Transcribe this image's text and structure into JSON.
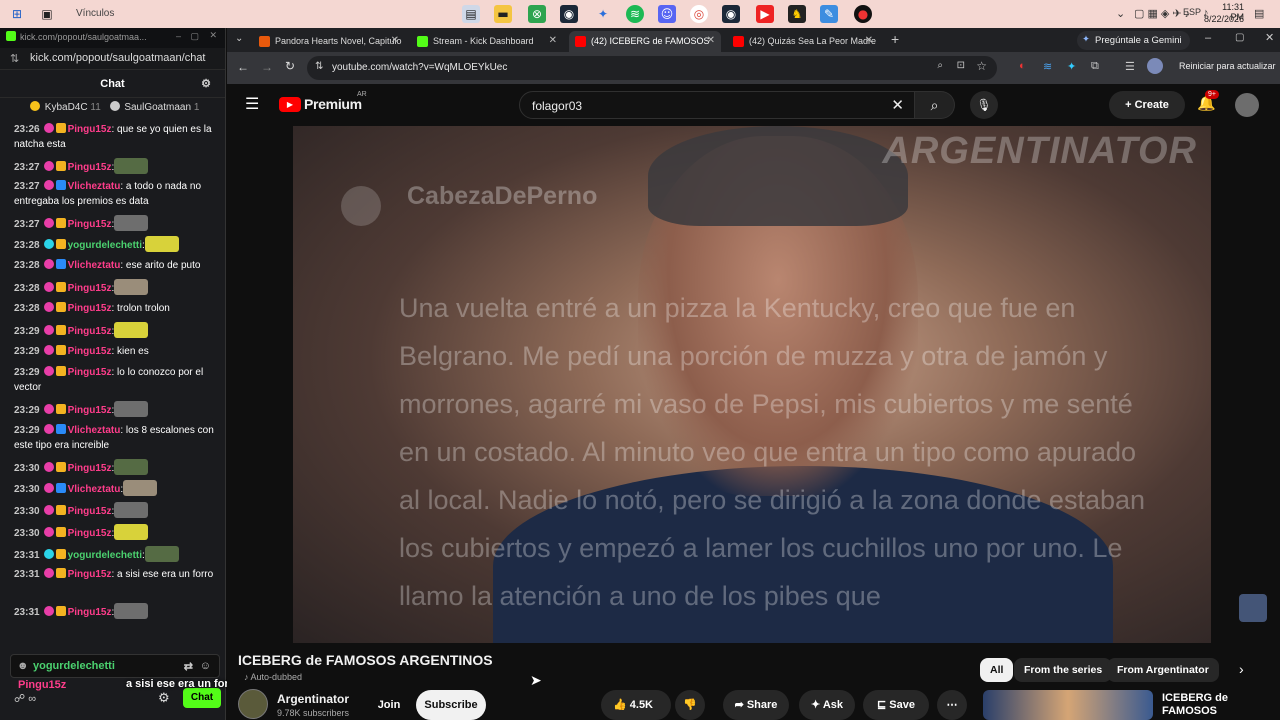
{
  "taskbar": {
    "vinculos": "Vínculos",
    "time": "11:31 PM",
    "date": "8/22/2026",
    "lang": "ESP"
  },
  "kick_window": {
    "title": "kick.com/popout/saulgoatmaa...",
    "address": "kick.com/popout/saulgoatmaan/chat",
    "chat_title": "Chat",
    "pinned": [
      {
        "name": "KybaD4C",
        "count": "11"
      },
      {
        "name": "SaulGoatmaan",
        "count": "1"
      }
    ],
    "messages": [
      {
        "time": "23:26",
        "user": "Pingu15z",
        "text": ": que se yo quien es la natcha esta",
        "emote": false,
        "color": "u1"
      },
      {
        "time": "23:27",
        "user": "Pingu15z",
        "text": ":",
        "emote": true,
        "color": "u1"
      },
      {
        "time": "23:27",
        "user": "Vlicheztatu",
        "text": ": a todo o nada no entregaba los premios es data",
        "emote": false,
        "color": "u2"
      },
      {
        "time": "23:27",
        "user": "Pingu15z",
        "text": ":",
        "emote": true,
        "color": "u1"
      },
      {
        "time": "23:28",
        "user": "yogurdelechetti",
        "text": ":",
        "emote": true,
        "color": "u3"
      },
      {
        "time": "23:28",
        "user": "Vlicheztatu",
        "text": ": ese arito de puto",
        "emote": false,
        "color": "u2"
      },
      {
        "time": "23:28",
        "user": "Pingu15z",
        "text": ":",
        "emote": true,
        "color": "u1"
      },
      {
        "time": "23:28",
        "user": "Pingu15z",
        "text": ": trolon trolon",
        "emote": false,
        "color": "u1"
      },
      {
        "time": "23:29",
        "user": "Pingu15z",
        "text": ":",
        "emote": true,
        "color": "u1"
      },
      {
        "time": "23:29",
        "user": "Pingu15z",
        "text": ": kien es",
        "emote": false,
        "color": "u1"
      },
      {
        "time": "23:29",
        "user": "Pingu15z",
        "text": ": lo lo conozco por el vector",
        "emote": false,
        "color": "u1"
      },
      {
        "time": "23:29",
        "user": "Pingu15z",
        "text": ":",
        "emote": true,
        "color": "u1"
      },
      {
        "time": "23:29",
        "user": "Vlicheztatu",
        "text": ": los 8 escalones con este tipo era increible",
        "emote": false,
        "color": "u2"
      },
      {
        "time": "23:30",
        "user": "Pingu15z",
        "text": ":",
        "emote": true,
        "color": "u1"
      },
      {
        "time": "23:30",
        "user": "Vlicheztatu",
        "text": ":",
        "emote": true,
        "color": "u2"
      },
      {
        "time": "23:30",
        "user": "Pingu15z",
        "text": ":",
        "emote": true,
        "color": "u1"
      },
      {
        "time": "23:30",
        "user": "Pingu15z",
        "text": ":",
        "emote": true,
        "color": "u1"
      },
      {
        "time": "23:31",
        "user": "yogurdelechetti",
        "text": ":",
        "emote": true,
        "color": "u3"
      },
      {
        "time": "23:31",
        "user": "Pingu15z",
        "text": ": a sisi ese era un forro",
        "emote": false,
        "color": "u1"
      },
      {
        "time": "23:31",
        "user": "Pingu15z",
        "text": ":",
        "emote": true,
        "color": "u1"
      }
    ],
    "input_user": "yogurdelechetti",
    "overlay_text": "a sisi ese era un forro",
    "overlay_user": "Pingu15z",
    "chat_button": "Chat"
  },
  "browser": {
    "tabs": [
      {
        "label": "Pandora Hearts Novel, Capitulo",
        "color": "#e8590c"
      },
      {
        "label": "Stream - Kick Dashboard",
        "color": "#53fc18"
      },
      {
        "label": "(42) ICEBERG de FAMOSOS",
        "color": "#ff0000"
      },
      {
        "label": "(42) Quizás Sea La Peor Madre",
        "color": "#ff0000"
      }
    ],
    "gemini": "Pregúntale a Gemini",
    "url": "youtube.com/watch?v=WqMLOEYkUec",
    "restart": "Reiniciar para actualizar"
  },
  "youtube": {
    "logo": "Premium",
    "region": "AR",
    "search_value": "folagor03",
    "create": "Create",
    "notif_count": "9+",
    "video": {
      "watermark": "ARGENTINATOR",
      "reddit_user": "CabezaDePerno",
      "story": "Una vuelta entré a un pizza la Kentucky, creo que fue en Belgrano. Me pedí una porción de muzza y otra de jamón y morrones, agarré mi vaso de Pepsi, mis cubiertos y me senté en un costado. Al minuto veo que entra un tipo como apurado al local. Nadie lo notó, pero se dirigió a la zona donde estaban los cubiertos y empezó a lamer los cuchillos uno por uno. Le llamo la atención a uno de los pibes que"
    },
    "title": "ICEBERG de FAMOSOS ARGENTINOS",
    "auto_dubbed": "Auto-dubbed",
    "channel": "Argentinator",
    "subscribers": "9.78K subscribers",
    "join": "Join",
    "subscribe": "Subscribe",
    "likes": "4.5K",
    "share": "Share",
    "ask": "Ask",
    "save": "Save",
    "chips": [
      "All",
      "From the series",
      "From Argentinator"
    ],
    "rec_title": "ICEBERG de FAMOSOS"
  }
}
